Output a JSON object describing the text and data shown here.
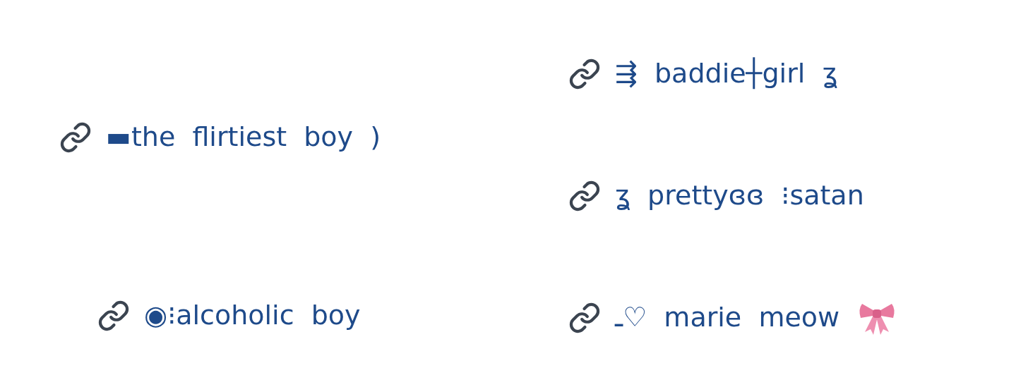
{
  "left_links": [
    {
      "text": "▬the  flirtiest  boy  )"
    },
    {
      "text": "◉⁝alcoholic  boy"
    }
  ],
  "right_links": [
    {
      "text": "⇶  baddie┼girl  ʓ"
    },
    {
      "text": "ʓ  prettyɞɞ  ⁝satan"
    },
    {
      "text": "ـ♡  marie  meow"
    }
  ]
}
